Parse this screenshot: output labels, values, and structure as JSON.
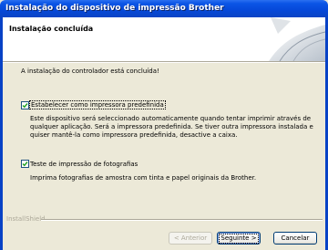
{
  "window": {
    "title": "Instalação do dispositivo de impressão Brother"
  },
  "header": {
    "heading": "Instalação concluída"
  },
  "body": {
    "completed_text": "A instalação do controlador está concluída!",
    "option_default": {
      "label": "Estabelecer como impressora predefinida",
      "checked": true,
      "description_lines": [
        "Este dispositivo será seleccionado automaticamente quando tentar imprimir através de",
        "qualquer aplicação. Será a impressora predefinida. Se tiver outra impressora instalada e",
        "quiser mantê-la como impressora predefinida, desactive a caixa."
      ]
    },
    "option_photo": {
      "label": "Teste de impressão de fotografias",
      "checked": true,
      "description": "Imprima fotografias de amostra com tinta e papel originais da Brother."
    }
  },
  "footer": {
    "brand": "InstallShield",
    "buttons": {
      "back": "< Anterior",
      "next": "Seguinte >",
      "cancel": "Cancelar"
    }
  }
}
